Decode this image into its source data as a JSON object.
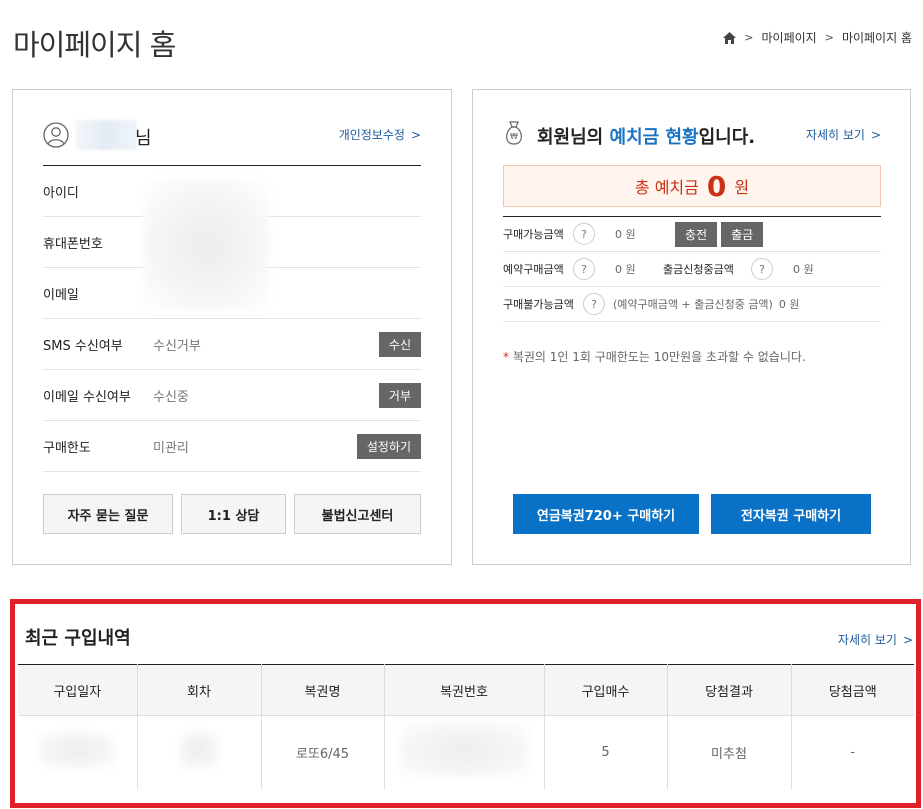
{
  "page": {
    "title": "마이페이지 홈"
  },
  "breadcrumb": {
    "items": [
      "마이페이지",
      "마이페이지 홈"
    ]
  },
  "profile": {
    "name_suffix": "님",
    "edit_link": "개인정보수정",
    "rows": {
      "id": {
        "label": "아이디"
      },
      "phone": {
        "label": "휴대폰번호"
      },
      "email": {
        "label": "이메일"
      },
      "sms": {
        "label": "SMS 수신여부",
        "value": "수신거부",
        "button": "수신"
      },
      "email_recv": {
        "label": "이메일 수신여부",
        "value": "수신중",
        "button": "거부"
      },
      "limit": {
        "label": "구매한도",
        "value": "미관리",
        "button": "설정하기"
      }
    },
    "buttons": {
      "faq": "자주 묻는 질문",
      "qa": "1:1 상담",
      "report": "불법신고센터"
    }
  },
  "deposit": {
    "title_a": "회원님의 ",
    "title_hl": "예치금 현황",
    "title_b": "입니다.",
    "more": "자세히 보기",
    "total_label": "총 예치금",
    "total_value": "0",
    "total_unit": "원",
    "help_glyph": "?",
    "rows": {
      "available": {
        "label": "구매가능금액",
        "value": "0 원",
        "charge": "충전",
        "withdraw": "출금"
      },
      "reserved": {
        "label": "예약구매금액",
        "value": "0 원"
      },
      "withdraw_req": {
        "label": "출금신청중금액",
        "value": "0 원"
      },
      "unavailable": {
        "label": "구매불가능금액",
        "note": "(예약구매금액 + 출금신청중 금액)",
        "value": "0 원"
      }
    },
    "notice_star": "*",
    "notice": "복권의 1인 1회 구매한도는 10만원을 초과할 수 없습니다.",
    "buy_pension": "연금복권720+ 구매하기",
    "buy_e": "전자복권 구매하기"
  },
  "recent": {
    "title": "최근 구입내역",
    "more": "자세히 보기",
    "headers": [
      "구입일자",
      "회차",
      "복권명",
      "복권번호",
      "구입매수",
      "당첨결과",
      "당첨금액"
    ],
    "row": {
      "name": "로또6/45",
      "count": "5",
      "result": "미추첨",
      "amount": "-"
    }
  }
}
